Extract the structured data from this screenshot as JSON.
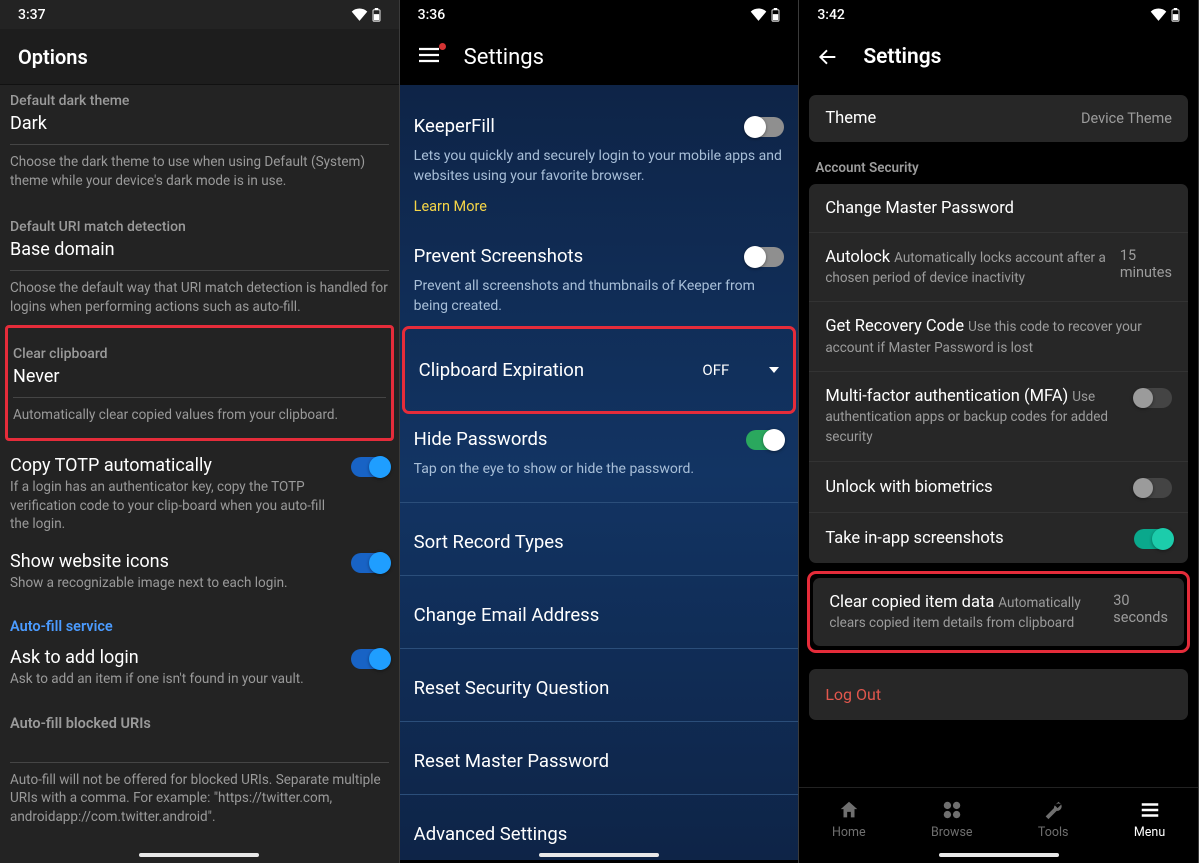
{
  "phone1": {
    "status_time": "3:37",
    "header_title": "Options",
    "dark_theme_label": "Default dark theme",
    "dark_theme_value": "Dark",
    "dark_theme_desc": "Choose the dark theme to use when using Default (System) theme while your device's dark mode is in use.",
    "uri_label": "Default URI match detection",
    "uri_value": "Base domain",
    "uri_desc": "Choose the default way that URI match detection is handled for logins when performing actions such as auto-fill.",
    "clear_label": "Clear clipboard",
    "clear_value": "Never",
    "clear_desc": "Automatically clear copied values from your clipboard.",
    "totp_title": "Copy TOTP automatically",
    "totp_desc": "If a login has an authenticator key, copy the TOTP verification code to your clip-board when you auto-fill the login.",
    "icons_title": "Show website icons",
    "icons_desc": "Show a recognizable image next to each login.",
    "autofill_section": "Auto-fill service",
    "ask_title": "Ask to add login",
    "ask_desc": "Ask to add an item if one isn't found in your vault.",
    "blocked_title": "Auto-fill blocked URIs",
    "blocked_desc": "Auto-fill will not be offered for blocked URIs. Separate multiple URIs with a comma. For example: \"https://twitter.com, androidapp://com.twitter.android\"."
  },
  "phone2": {
    "status_time": "3:36",
    "header_title": "Settings",
    "keeperfill_title": "KeeperFill",
    "keeperfill_desc": "Lets you quickly and securely login to your mobile apps and websites using your favorite browser.",
    "learn_more": "Learn More",
    "prevent_title": "Prevent Screenshots",
    "prevent_desc": "Prevent all screenshots and thumbnails of Keeper from being created.",
    "clipboard_title": "Clipboard Expiration",
    "clipboard_value": "OFF",
    "hide_title": "Hide Passwords",
    "hide_desc": "Tap on the eye to show or hide the password.",
    "sort_title": "Sort Record Types",
    "email_title": "Change Email Address",
    "reset_sq_title": "Reset Security Question",
    "reset_mp_title": "Reset Master Password",
    "advanced_title": "Advanced Settings"
  },
  "phone3": {
    "status_time": "3:42",
    "header_title": "Settings",
    "theme_label": "Theme",
    "theme_value": "Device Theme",
    "acct_section": "Account Security",
    "change_mp": "Change Master Password",
    "autolock_title": "Autolock",
    "autolock_value": "15 minutes",
    "autolock_desc": "Automatically locks account after a chosen period of device inactivity",
    "recovery_title": "Get Recovery Code",
    "recovery_desc": "Use this code to recover your account if Master Password is lost",
    "mfa_title": "Multi-factor authentication (MFA)",
    "mfa_desc": "Use authentication apps or backup codes for added security",
    "biometrics_title": "Unlock with biometrics",
    "screenshots_title": "Take in-app screenshots",
    "clearitem_title": "Clear copied item data",
    "clearitem_value": "30 seconds",
    "clearitem_desc": "Automatically clears copied item details from clipboard",
    "logout": "Log Out",
    "nav": {
      "home": "Home",
      "browse": "Browse",
      "tools": "Tools",
      "menu": "Menu"
    }
  }
}
